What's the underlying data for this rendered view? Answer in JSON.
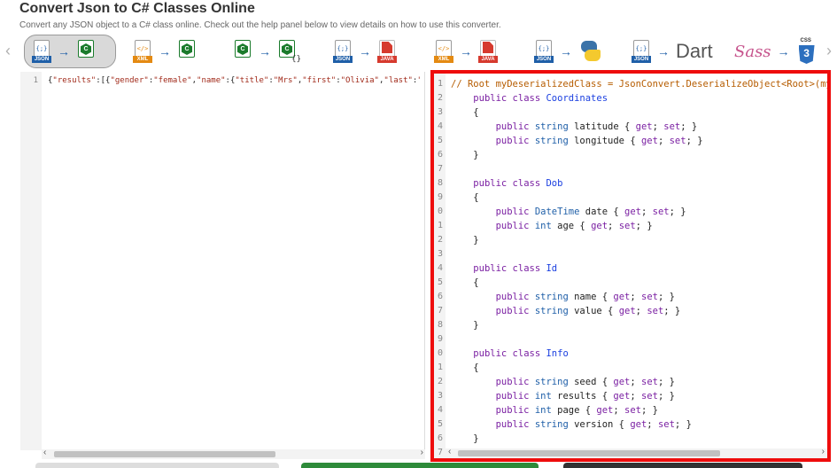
{
  "header": {
    "title": "Convert Json to C# Classes Online",
    "subtitle": "Convert any JSON object to a C# class online. Check out the help panel below to view details on how to use this converter."
  },
  "toolbar": {
    "prev_arrow": "‹",
    "next_arrow": "›",
    "arrow_glyph": "→",
    "json_tag": "JSON",
    "xml_tag": "XML",
    "java_tag": "JAVA",
    "json_glyph": "{;}",
    "xml_glyph": "</>",
    "cs_glyph": "C",
    "braces_glyph": "{}",
    "dart_label": "Dart",
    "sass_label": "Sass",
    "css_label": "CSS",
    "css_glyph": "3",
    "tools": [
      {
        "from": "json-icon",
        "to": "csharp-icon",
        "active": true
      },
      {
        "from": "xml-icon",
        "to": "csharp-icon"
      },
      {
        "from": "csharp-icon",
        "to": "csharp-braces-icon"
      },
      {
        "from": "json-icon",
        "to": "java-icon"
      },
      {
        "from": "xml-icon",
        "to": "java-icon"
      },
      {
        "from": "json-icon",
        "to": "python-icon"
      },
      {
        "from": "json-icon",
        "to": "dart-text"
      },
      {
        "from": "sass-icon",
        "to": "css3-icon"
      }
    ]
  },
  "input_editor": {
    "line_number": "1",
    "text_parts": [
      "{",
      "\"results\"",
      ":[{",
      "\"gender\"",
      ":",
      "\"female\"",
      ",",
      "\"name\"",
      ":{",
      "\"title\"",
      ":",
      "\"Mrs\"",
      ",",
      "\"first\"",
      ":",
      "\"Olivia\"",
      ",",
      "\"last\"",
      ":",
      "\"Ho"
    ]
  },
  "output_editor": {
    "line_numbers": [
      "1",
      "2",
      "3",
      "4",
      "5",
      "6",
      "7",
      "8",
      "9",
      "0",
      "1",
      "2",
      "3",
      "4",
      "5",
      "6",
      "7",
      "8",
      "9",
      "0",
      "1",
      "2",
      "3",
      "4",
      "5",
      "6",
      "7"
    ],
    "lines": [
      [
        [
          "comment",
          "// Root myDeserializedClass = JsonConvert.DeserializeObject<Root>(my"
        ]
      ],
      [
        [
          "pad",
          "    "
        ],
        [
          "kw",
          "public class "
        ],
        [
          "cls",
          "Coordinates"
        ]
      ],
      [
        [
          "pad",
          "    "
        ],
        [
          "prop",
          "{"
        ]
      ],
      [
        [
          "pad",
          "        "
        ],
        [
          "kw",
          "public "
        ],
        [
          "type",
          "string "
        ],
        [
          "prop",
          "latitude { "
        ],
        [
          "kw",
          "get"
        ],
        [
          "prop",
          "; "
        ],
        [
          "kw",
          "set"
        ],
        [
          "prop",
          "; }"
        ]
      ],
      [
        [
          "pad",
          "        "
        ],
        [
          "kw",
          "public "
        ],
        [
          "type",
          "string "
        ],
        [
          "prop",
          "longitude { "
        ],
        [
          "kw",
          "get"
        ],
        [
          "prop",
          "; "
        ],
        [
          "kw",
          "set"
        ],
        [
          "prop",
          "; }"
        ]
      ],
      [
        [
          "pad",
          "    "
        ],
        [
          "prop",
          "}"
        ]
      ],
      [],
      [
        [
          "pad",
          "    "
        ],
        [
          "kw",
          "public class "
        ],
        [
          "cls",
          "Dob"
        ]
      ],
      [
        [
          "pad",
          "    "
        ],
        [
          "prop",
          "{"
        ]
      ],
      [
        [
          "pad",
          "        "
        ],
        [
          "kw",
          "public "
        ],
        [
          "type",
          "DateTime "
        ],
        [
          "prop",
          "date { "
        ],
        [
          "kw",
          "get"
        ],
        [
          "prop",
          "; "
        ],
        [
          "kw",
          "set"
        ],
        [
          "prop",
          "; }"
        ]
      ],
      [
        [
          "pad",
          "        "
        ],
        [
          "kw",
          "public "
        ],
        [
          "type",
          "int "
        ],
        [
          "prop",
          "age { "
        ],
        [
          "kw",
          "get"
        ],
        [
          "prop",
          "; "
        ],
        [
          "kw",
          "set"
        ],
        [
          "prop",
          "; }"
        ]
      ],
      [
        [
          "pad",
          "    "
        ],
        [
          "prop",
          "}"
        ]
      ],
      [],
      [
        [
          "pad",
          "    "
        ],
        [
          "kw",
          "public class "
        ],
        [
          "cls",
          "Id"
        ]
      ],
      [
        [
          "pad",
          "    "
        ],
        [
          "prop",
          "{"
        ]
      ],
      [
        [
          "pad",
          "        "
        ],
        [
          "kw",
          "public "
        ],
        [
          "type",
          "string "
        ],
        [
          "prop",
          "name { "
        ],
        [
          "kw",
          "get"
        ],
        [
          "prop",
          "; "
        ],
        [
          "kw",
          "set"
        ],
        [
          "prop",
          "; }"
        ]
      ],
      [
        [
          "pad",
          "        "
        ],
        [
          "kw",
          "public "
        ],
        [
          "type",
          "string "
        ],
        [
          "prop",
          "value { "
        ],
        [
          "kw",
          "get"
        ],
        [
          "prop",
          "; "
        ],
        [
          "kw",
          "set"
        ],
        [
          "prop",
          "; }"
        ]
      ],
      [
        [
          "pad",
          "    "
        ],
        [
          "prop",
          "}"
        ]
      ],
      [],
      [
        [
          "pad",
          "    "
        ],
        [
          "kw",
          "public class "
        ],
        [
          "cls",
          "Info"
        ]
      ],
      [
        [
          "pad",
          "    "
        ],
        [
          "prop",
          "{"
        ]
      ],
      [
        [
          "pad",
          "        "
        ],
        [
          "kw",
          "public "
        ],
        [
          "type",
          "string "
        ],
        [
          "prop",
          "seed { "
        ],
        [
          "kw",
          "get"
        ],
        [
          "prop",
          "; "
        ],
        [
          "kw",
          "set"
        ],
        [
          "prop",
          "; }"
        ]
      ],
      [
        [
          "pad",
          "        "
        ],
        [
          "kw",
          "public "
        ],
        [
          "type",
          "int "
        ],
        [
          "prop",
          "results { "
        ],
        [
          "kw",
          "get"
        ],
        [
          "prop",
          "; "
        ],
        [
          "kw",
          "set"
        ],
        [
          "prop",
          "; }"
        ]
      ],
      [
        [
          "pad",
          "        "
        ],
        [
          "kw",
          "public "
        ],
        [
          "type",
          "int "
        ],
        [
          "prop",
          "page { "
        ],
        [
          "kw",
          "get"
        ],
        [
          "prop",
          "; "
        ],
        [
          "kw",
          "set"
        ],
        [
          "prop",
          "; }"
        ]
      ],
      [
        [
          "pad",
          "        "
        ],
        [
          "kw",
          "public "
        ],
        [
          "type",
          "string "
        ],
        [
          "prop",
          "version { "
        ],
        [
          "kw",
          "get"
        ],
        [
          "prop",
          "; "
        ],
        [
          "kw",
          "set"
        ],
        [
          "prop",
          "; }"
        ]
      ],
      [
        [
          "pad",
          "    "
        ],
        [
          "prop",
          "}"
        ]
      ],
      []
    ]
  },
  "scrollbars": {
    "left_glyph": "‹",
    "right_glyph": "›"
  },
  "colors": {
    "highlight_border": "#ee0c0c",
    "bottom_bar_left": "#dddddd",
    "bottom_bar_mid": "#2e8b3a",
    "bottom_bar_right": "#333333"
  }
}
